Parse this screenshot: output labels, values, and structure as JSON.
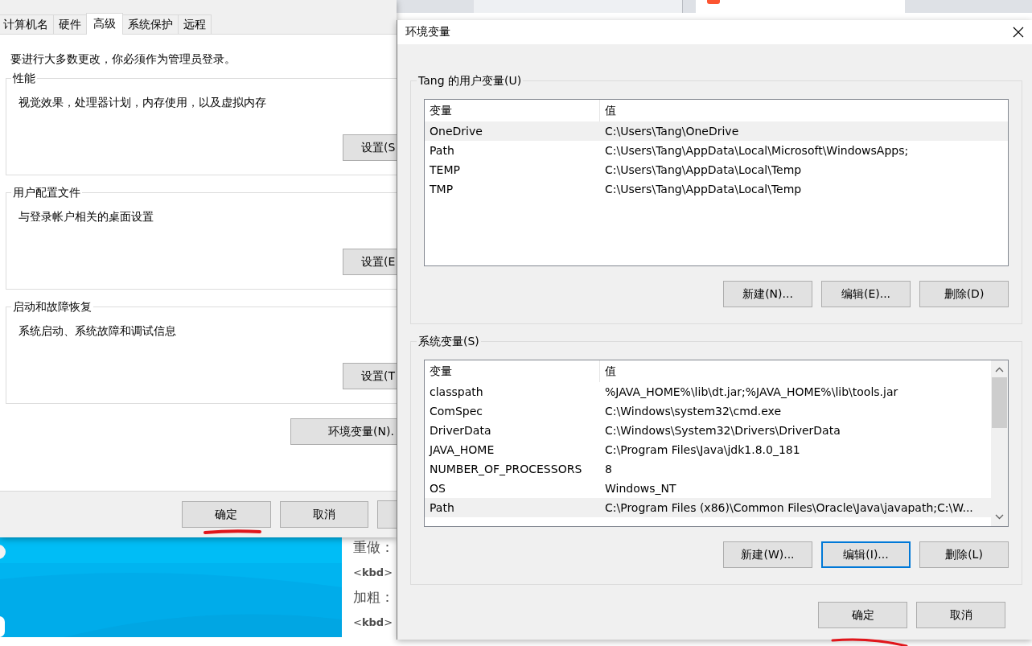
{
  "browser_tabs": [
    {
      "selected": false
    },
    {
      "selected": true
    }
  ],
  "background_editor": {
    "lines": [
      "重做：",
      "<**kbd**>",
      "加粗：",
      "<**kbd**>"
    ]
  },
  "system_properties": {
    "tabs": [
      {
        "label": "计算机名",
        "selected": false
      },
      {
        "label": "硬件",
        "selected": false
      },
      {
        "label": "高级",
        "selected": true
      },
      {
        "label": "系统保护",
        "selected": false
      },
      {
        "label": "远程",
        "selected": false
      }
    ],
    "notice": "要进行大多数更改，你必须作为管理员登录。",
    "groups": [
      {
        "title": "性能",
        "description": "视觉效果，处理器计划，内存使用，以及虚拟内存",
        "button": "设置(S"
      },
      {
        "title": "用户配置文件",
        "description": "与登录帐户相关的桌面设置",
        "button": "设置(E"
      },
      {
        "title": "启动和故障恢复",
        "description": "系统启动、系统故障和调试信息",
        "button": "设置(T"
      }
    ],
    "env_button": "环境变量(N).",
    "buttons": [
      "确定",
      "取消"
    ]
  },
  "environment_dialog": {
    "title": "环境变量",
    "user_group": {
      "title": "Tang 的用户变量(U)",
      "columns": [
        "变量",
        "值"
      ],
      "rows": [
        {
          "name": "OneDrive",
          "value": "C:\\Users\\Tang\\OneDrive",
          "selected": true
        },
        {
          "name": "Path",
          "value": "C:\\Users\\Tang\\AppData\\Local\\Microsoft\\WindowsApps;",
          "selected": false
        },
        {
          "name": "TEMP",
          "value": "C:\\Users\\Tang\\AppData\\Local\\Temp",
          "selected": false
        },
        {
          "name": "TMP",
          "value": "C:\\Users\\Tang\\AppData\\Local\\Temp",
          "selected": false
        }
      ],
      "buttons": [
        {
          "label": "新建(N)...",
          "focused": false
        },
        {
          "label": "编辑(E)...",
          "focused": false
        },
        {
          "label": "删除(D)",
          "focused": false
        }
      ]
    },
    "system_group": {
      "title": "系统变量(S)",
      "columns": [
        "变量",
        "值"
      ],
      "rows": [
        {
          "name": "classpath",
          "value": "%JAVA_HOME%\\lib\\dt.jar;%JAVA_HOME%\\lib\\tools.jar",
          "selected": false
        },
        {
          "name": "ComSpec",
          "value": "C:\\Windows\\system32\\cmd.exe",
          "selected": false
        },
        {
          "name": "DriverData",
          "value": "C:\\Windows\\System32\\Drivers\\DriverData",
          "selected": false
        },
        {
          "name": "JAVA_HOME",
          "value": "C:\\Program Files\\Java\\jdk1.8.0_181",
          "selected": false
        },
        {
          "name": "NUMBER_OF_PROCESSORS",
          "value": "8",
          "selected": false
        },
        {
          "name": "OS",
          "value": "Windows_NT",
          "selected": false
        },
        {
          "name": "Path",
          "value": "C:\\Program Files (x86)\\Common Files\\Oracle\\Java\\javapath;C:\\W...",
          "selected": true
        }
      ],
      "buttons": [
        {
          "label": "新建(W)...",
          "focused": false
        },
        {
          "label": "编辑(I)...",
          "focused": true
        },
        {
          "label": "删除(L)",
          "focused": false
        }
      ]
    },
    "buttons": [
      "确定",
      "取消"
    ]
  }
}
